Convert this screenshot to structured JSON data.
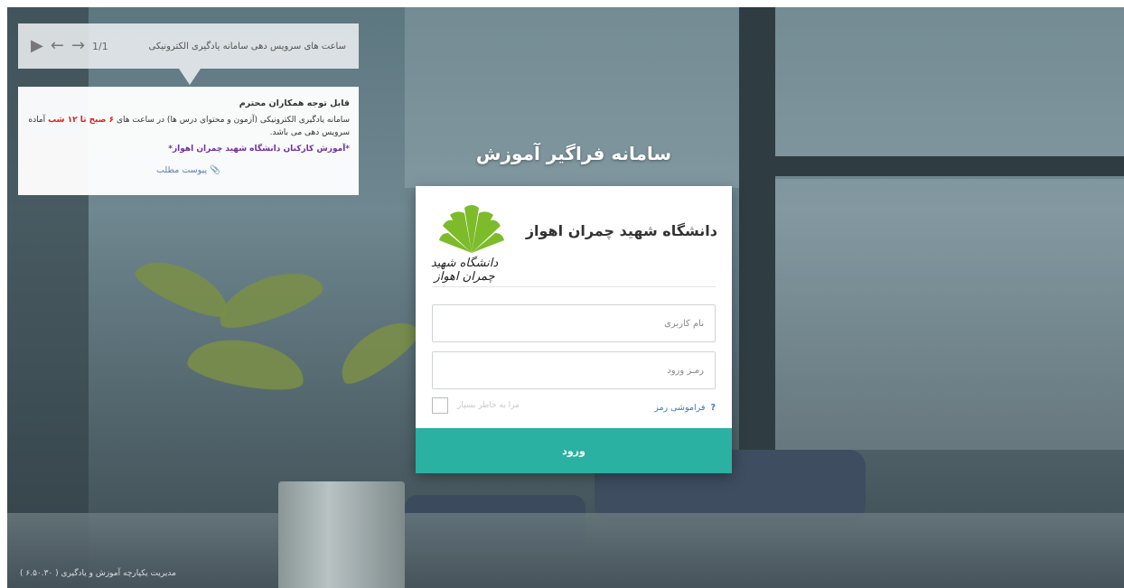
{
  "announcement": {
    "header_title": "ساعت های سرویس دهی سامانه یادگیری الکترونیکی",
    "pager": "1/1",
    "title": "قابل توجه همکاران محترم",
    "body_before": "سامانه یادگیری الکترونیکی (آزمون و محتوای درس ها) در ساعت های",
    "body_hours": "۶ صبح  تا ۱۲ شب",
    "body_after": "آماده سرویس دهی می باشد.",
    "credit": "*آموزش کارکنان دانشگاه شهید چمران اهواز*",
    "attachment_label": "پیوست مطلب"
  },
  "login": {
    "system_title": "سامانه فراگیر آموزش",
    "university_name": "دانشگاه شهید چمران اهواز",
    "logo_text": "دانشگاه شهید چمران اهواز",
    "username_placeholder": "نام کاربری",
    "password_placeholder": "رمـز ورود",
    "forgot_label": "فراموشی رمز",
    "forgot_mark": "?",
    "remember_label": "مرا به خاطر بسپار",
    "submit_label": "ورود"
  },
  "footer": {
    "text": "مدیریت یکپارچه آموزش و یادگیری ( ۶.۵۰.۳۰ )"
  },
  "colors": {
    "accent": "#2ab1a1",
    "link": "#3b78c4",
    "highlight": "#e0201b"
  }
}
